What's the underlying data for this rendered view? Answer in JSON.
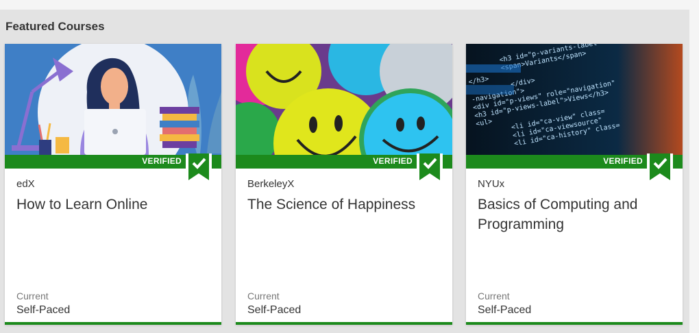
{
  "section": {
    "title": "Featured Courses"
  },
  "badge": {
    "label": "VERIFIED",
    "color": "#1c8a1c"
  },
  "cards": [
    {
      "org": "edX",
      "title": "How to Learn Online",
      "pace_label": "Current",
      "pace_value": "Self-Paced",
      "image": "woman-at-laptop-illustration"
    },
    {
      "org": "BerkeleyX",
      "title": "The Science of Happiness",
      "pace_label": "Current",
      "pace_value": "Self-Paced",
      "image": "smiley-face-buttons-photo"
    },
    {
      "org": "NYUx",
      "title": "Basics of Computing and Programming",
      "pace_label": "Current",
      "pace_value": "Self-Paced",
      "image": "html-code-screen-photo"
    }
  ]
}
